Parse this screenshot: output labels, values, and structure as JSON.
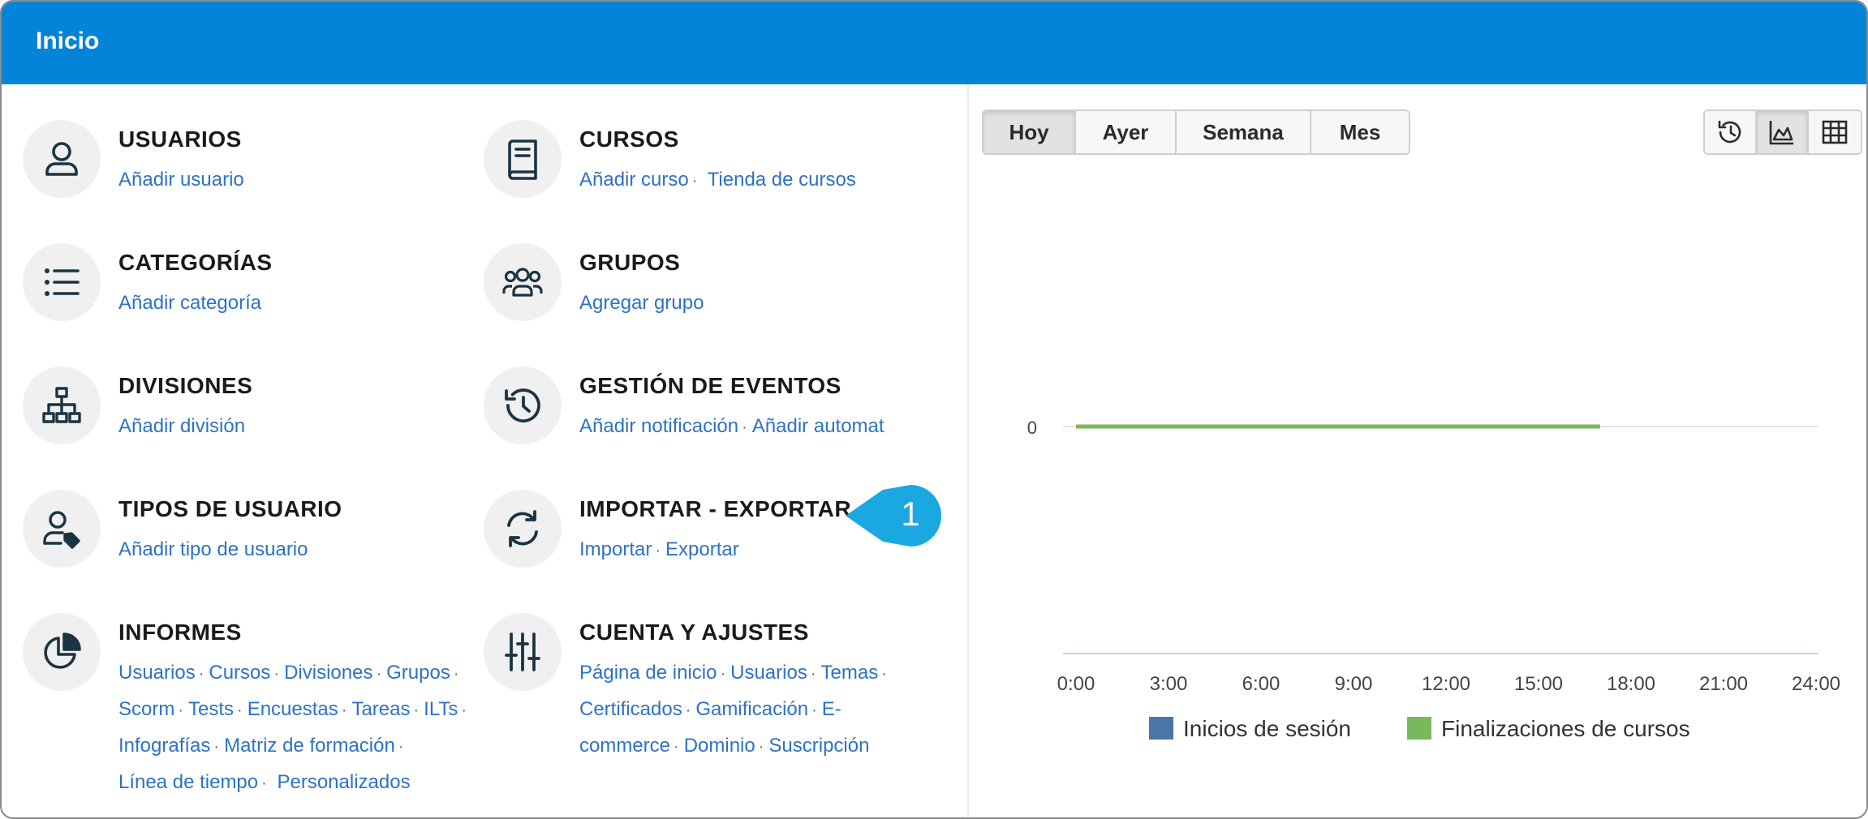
{
  "header": {
    "title": "Inicio"
  },
  "sections": {
    "usuarios": {
      "title": "USUARIOS",
      "links": [
        "Añadir usuario"
      ]
    },
    "cursos": {
      "title": "CURSOS",
      "links": [
        "Añadir curso",
        "Tienda de cursos"
      ]
    },
    "categorias": {
      "title": "CATEGORÍAS",
      "links": [
        "Añadir categoría"
      ]
    },
    "grupos": {
      "title": "GRUPOS",
      "links": [
        "Agregar grupo"
      ]
    },
    "divisiones": {
      "title": "DIVISIONES",
      "links": [
        "Añadir división"
      ]
    },
    "eventos": {
      "title": "GESTIÓN DE EVENTOS",
      "links": [
        "Añadir notificación",
        "Añadir automat"
      ]
    },
    "tipos": {
      "title": "TIPOS DE USUARIO",
      "links": [
        "Añadir tipo de usuario"
      ]
    },
    "importar": {
      "title": "IMPORTAR - EXPORTAR",
      "links": [
        "Importar",
        "Exportar"
      ]
    },
    "informes": {
      "title": "INFORMES",
      "links": [
        "Usuarios",
        "Cursos",
        "Divisiones",
        "Grupos",
        "Scorm",
        "Tests",
        "Encuestas",
        "Tareas",
        "ILTs",
        "Infografías",
        "Matriz de formación",
        "Línea de tiempo",
        "Personalizados"
      ]
    },
    "cuenta": {
      "title": "CUENTA Y AJUSTES",
      "links": [
        "Página de inicio",
        "Usuarios",
        "Temas",
        "Certificados",
        "Gamificación",
        "E-",
        "commerce",
        "Dominio",
        "Suscripción"
      ]
    }
  },
  "callout": {
    "number": "1",
    "color": "#1ba8e0"
  },
  "range_buttons": [
    "Hoy",
    "Ayer",
    "Semana",
    "Mes"
  ],
  "range_selected": "Hoy",
  "view_buttons": [
    "history-icon",
    "area-chart-icon",
    "table-icon"
  ],
  "view_selected": "area-chart-icon",
  "chart_data": {
    "type": "line",
    "title": "",
    "xlabel": "",
    "ylabel": "",
    "x": [
      "0:00",
      "3:00",
      "6:00",
      "9:00",
      "12:00",
      "15:00",
      "18:00",
      "21:00",
      "24:00"
    ],
    "y_ticks": [
      "0"
    ],
    "series": [
      {
        "name": "Inicios de sesión",
        "color": "#4a76a8",
        "x_range": [
          0,
          17
        ],
        "values": [
          0,
          0,
          0,
          0,
          0,
          0
        ]
      },
      {
        "name": "Finalizaciones de cursos",
        "color": "#7ab85e",
        "x_range": [
          0,
          17
        ],
        "values": [
          0,
          0,
          0,
          0,
          0,
          0
        ]
      }
    ],
    "xlim": [
      0,
      24
    ],
    "legend": "bottom",
    "grid": true
  }
}
